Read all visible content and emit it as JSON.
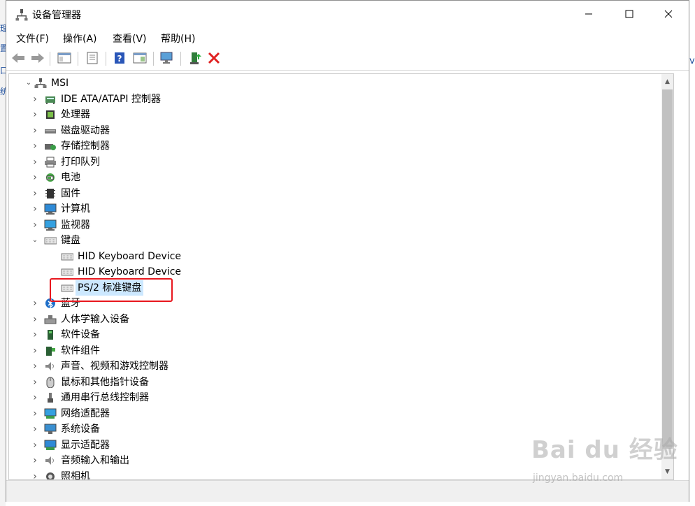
{
  "window": {
    "title": "设备管理器"
  },
  "menu": [
    "文件(F)",
    "操作(A)",
    "查看(V)",
    "帮助(H)"
  ],
  "tree": {
    "root": "MSI",
    "nodes": [
      {
        "label": "IDE ATA/ATAPI 控制器",
        "icon": "ide-controller-icon"
      },
      {
        "label": "处理器",
        "icon": "processor-icon"
      },
      {
        "label": "磁盘驱动器",
        "icon": "disk-drive-icon"
      },
      {
        "label": "存储控制器",
        "icon": "storage-controller-icon"
      },
      {
        "label": "打印队列",
        "icon": "printer-icon"
      },
      {
        "label": "电池",
        "icon": "battery-icon"
      },
      {
        "label": "固件",
        "icon": "firmware-icon"
      },
      {
        "label": "计算机",
        "icon": "computer-icon"
      },
      {
        "label": "监视器",
        "icon": "monitor-icon"
      },
      {
        "label": "键盘",
        "icon": "keyboard-icon",
        "expanded": true,
        "children": [
          "HID Keyboard Device",
          "HID Keyboard Device",
          "PS/2 标准键盘"
        ]
      },
      {
        "label": "蓝牙",
        "icon": "bluetooth-icon"
      },
      {
        "label": "人体学输入设备",
        "icon": "hid-icon"
      },
      {
        "label": "软件设备",
        "icon": "software-device-icon"
      },
      {
        "label": "软件组件",
        "icon": "software-component-icon"
      },
      {
        "label": "声音、视频和游戏控制器",
        "icon": "sound-icon"
      },
      {
        "label": "鼠标和其他指针设备",
        "icon": "mouse-icon"
      },
      {
        "label": "通用串行总线控制器",
        "icon": "usb-icon"
      },
      {
        "label": "网络适配器",
        "icon": "network-adapter-icon"
      },
      {
        "label": "系统设备",
        "icon": "system-device-icon"
      },
      {
        "label": "显示适配器",
        "icon": "display-adapter-icon"
      },
      {
        "label": "音频输入和输出",
        "icon": "audio-io-icon"
      },
      {
        "label": "照相机",
        "icon": "camera-icon"
      }
    ]
  },
  "watermark": {
    "line1": "Bai du 经验",
    "line2": "jingyan.baidu.com"
  },
  "colors": {
    "selection": "#cce8ff",
    "highlight_box": "#e8171e",
    "toolbar_remove": "#e02020"
  }
}
